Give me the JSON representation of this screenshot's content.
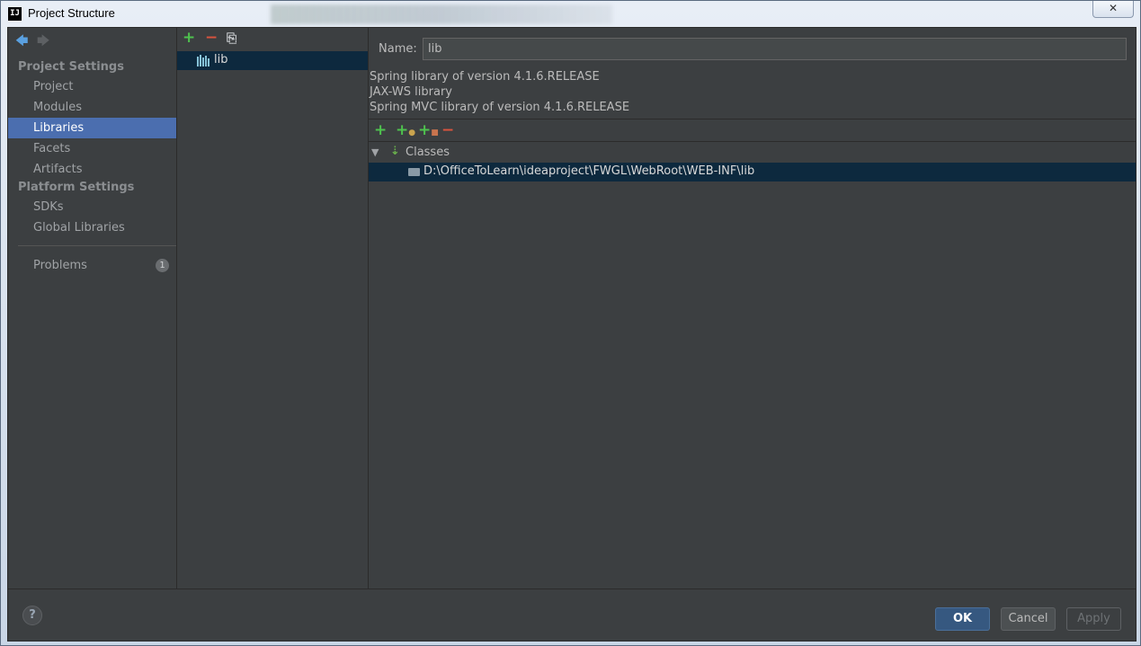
{
  "window": {
    "title": "Project Structure",
    "close_glyph": "✕",
    "app_icon_text": "IJ"
  },
  "nav": {
    "back_glyph": "🡄",
    "forward_glyph": "🡆",
    "project_settings_header": "Project Settings",
    "items_project": [
      "Project",
      "Modules",
      "Libraries",
      "Facets",
      "Artifacts"
    ],
    "platform_settings_header": "Platform Settings",
    "items_platform": [
      "SDKs",
      "Global Libraries"
    ],
    "problems_label": "Problems",
    "problems_count": "1",
    "selected": "Libraries"
  },
  "libraries": {
    "toolbar": {
      "add": "+",
      "remove": "−",
      "copy": "⎘"
    },
    "items": [
      "lib"
    ]
  },
  "detail": {
    "name_label": "Name:",
    "name_value": "lib",
    "descriptions": [
      "Spring library of version 4.1.6.RELEASE",
      "JAX-WS library",
      "Spring MVC library of version 4.1.6.RELEASE"
    ],
    "classes_toolbar": {
      "add": "+",
      "remove": "−"
    },
    "tree": {
      "expand_glyph": "▼",
      "classes_label": "Classes",
      "path": "D:\\OfficeToLearn\\ideaproject\\FWGL\\WebRoot\\WEB-INF\\lib"
    }
  },
  "footer": {
    "help": "?",
    "ok": "OK",
    "cancel": "Cancel",
    "apply": "Apply"
  },
  "colors": {
    "panel_bg": "#3c3f41",
    "selection": "#4b6eaf",
    "tree_selection": "#0d293e",
    "ok_button": "#365880"
  }
}
